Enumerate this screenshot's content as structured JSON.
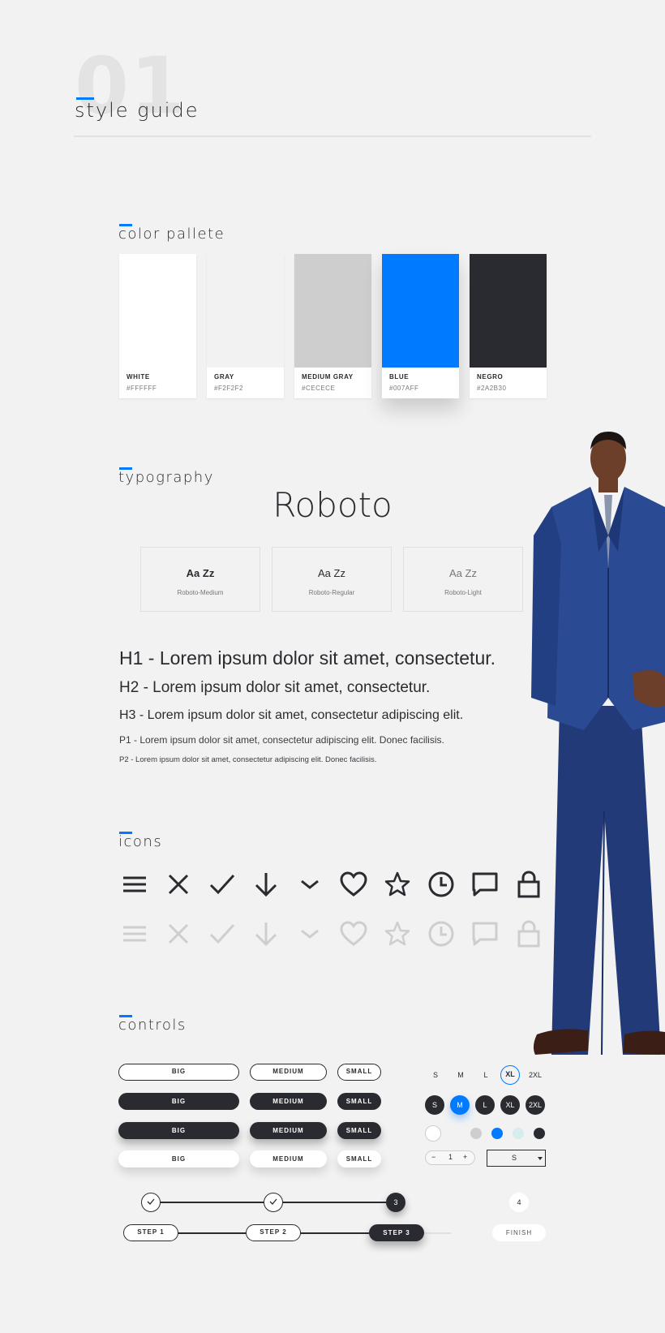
{
  "header": {
    "number": "01",
    "title": "style guide"
  },
  "sections": {
    "colors": "color pallete",
    "typography": "typography",
    "icons": "icons",
    "controls": "controls"
  },
  "palette": [
    {
      "name": "WHITE",
      "hex": "#FFFFFF"
    },
    {
      "name": "GRAY",
      "hex": "#F2F2F2"
    },
    {
      "name": "MEDIUM GRAY",
      "hex": "#CECECE"
    },
    {
      "name": "BLUE",
      "hex": "#007AFF"
    },
    {
      "name": "NEGRO",
      "hex": "#2A2B30"
    }
  ],
  "typography": {
    "font": "Roboto",
    "weights": [
      {
        "sample": "Aa Zz",
        "name": "Roboto-Medium"
      },
      {
        "sample": "Aa Zz",
        "name": "Roboto-Regular"
      },
      {
        "sample": "Aa Zz",
        "name": "Roboto-Light"
      }
    ],
    "h1": "H1 - Lorem ipsum dolor sit amet, consectetur.",
    "h2": "H2 - Lorem ipsum dolor sit amet, consectetur.",
    "h3": "H3 - Lorem ipsum dolor sit amet, consectetur adipiscing elit.",
    "p1": "P1 - Lorem ipsum dolor sit amet, consectetur adipiscing elit. Donec facilisis.",
    "p2": "P2 - Lorem ipsum dolor sit amet, consectetur adipiscing elit. Donec facilisis."
  },
  "icons": [
    "menu-icon",
    "close-icon",
    "check-icon",
    "arrow-down-icon",
    "chevron-down-icon",
    "heart-icon",
    "star-icon",
    "clock-icon",
    "chat-icon",
    "lock-icon"
  ],
  "icon_colors": {
    "active": "#2A2B30",
    "disabled": "#CECECE"
  },
  "buttons": {
    "big": "BIG",
    "medium": "MEDIUM",
    "small": "SMALL"
  },
  "sizes": [
    "S",
    "M",
    "L",
    "XL",
    "2XL"
  ],
  "size_text_selected": "XL",
  "size_dot_selected": "M",
  "color_options": [
    "#FFFFFF",
    "#CECECE",
    "#007AFF",
    "#D6ECEF",
    "#2A2B30"
  ],
  "quantity": {
    "minus": "−",
    "value": "1",
    "plus": "+"
  },
  "size_select": {
    "value": "S"
  },
  "progress": {
    "steps": [
      "STEP 1",
      "STEP 2",
      "STEP 3"
    ],
    "current_step": "3",
    "next_step": "4",
    "finish": "FINISH"
  }
}
